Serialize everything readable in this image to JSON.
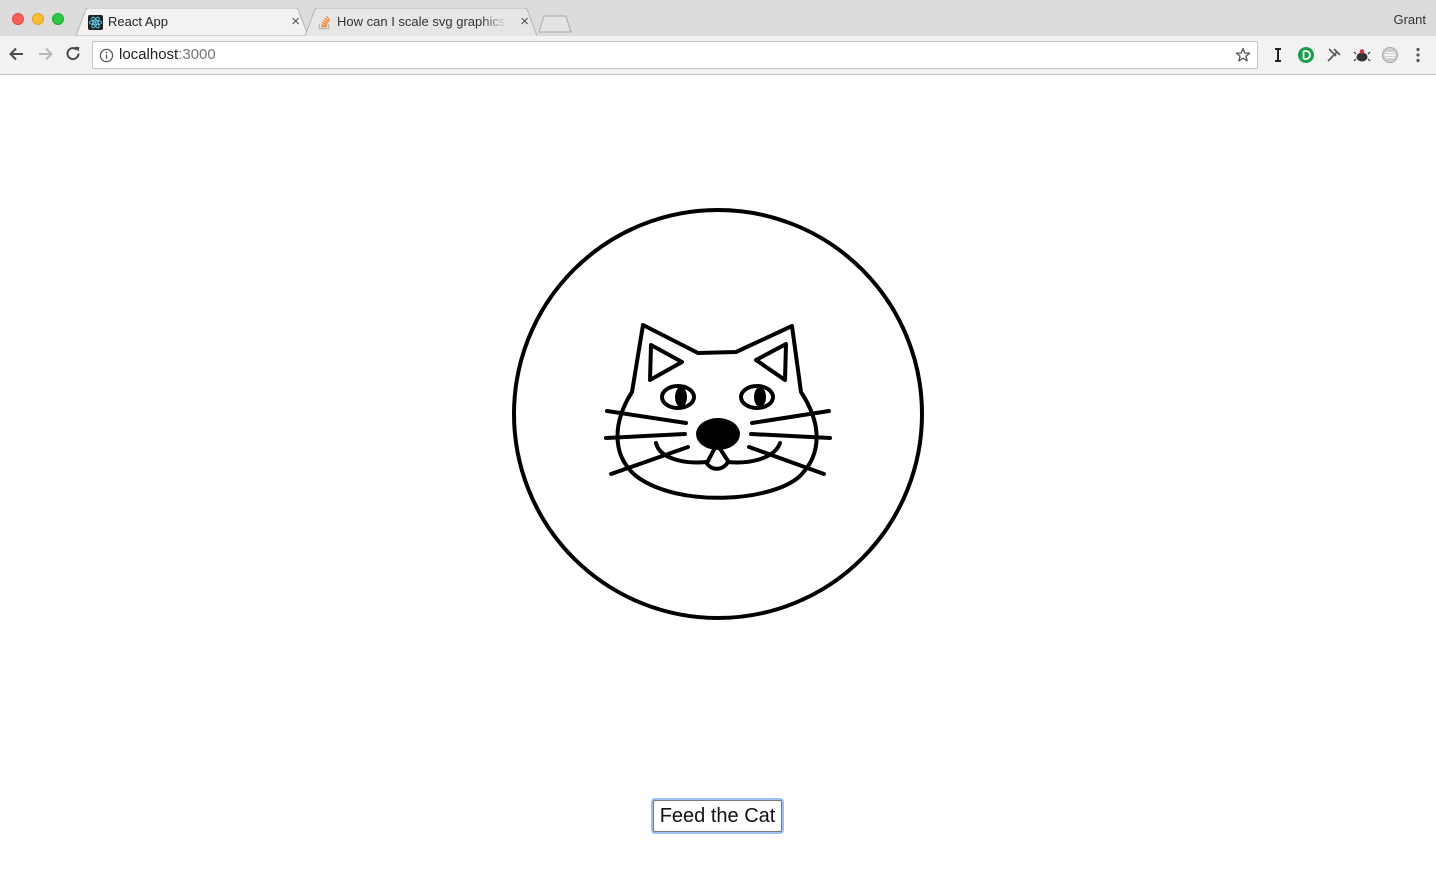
{
  "browser": {
    "tabs": [
      {
        "title": "React App",
        "icon": "react-logo-icon",
        "active": true
      },
      {
        "title": "How can I scale svg graphics g",
        "icon": "stackoverflow-icon",
        "active": false
      }
    ],
    "close_glyph": "×",
    "profile_name": "Grant",
    "address": {
      "host": "localhost",
      "port": ":3000"
    }
  },
  "page": {
    "illustration": "cat-face-icon",
    "feed_button_label": "Feed the Cat"
  },
  "colors": {
    "tabstrip": "#dcdcdc",
    "toolbar": "#f2f2f2",
    "focus_ring": "#9ec0ee",
    "drawing_stroke": "#000000"
  }
}
